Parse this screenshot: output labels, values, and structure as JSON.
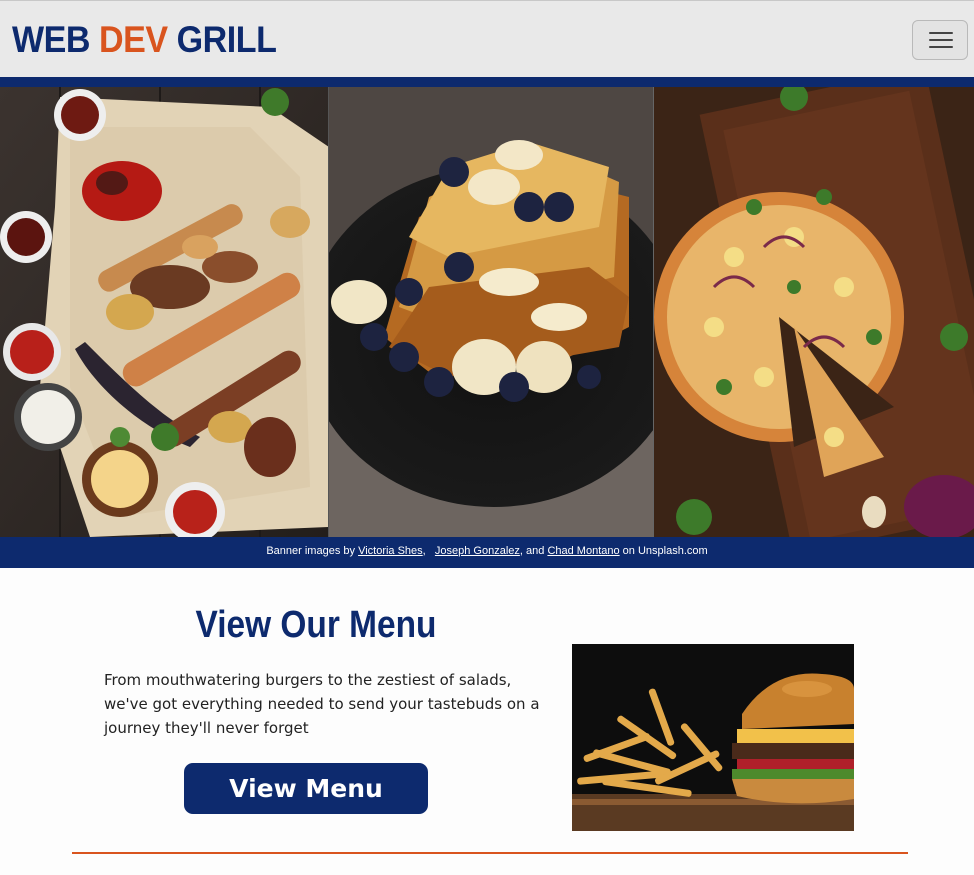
{
  "brand": {
    "part1": "WEB",
    "part2": "DEV",
    "part3": "GRILL"
  },
  "nav": {
    "toggler_icon": "hamburger-menu-icon"
  },
  "banner": {
    "images": [
      {
        "name": "grill-platter-image"
      },
      {
        "name": "french-toast-image"
      },
      {
        "name": "pizza-image"
      }
    ],
    "credit": {
      "prefix": "Banner images by",
      "author1": "Victoria Shes",
      "sep1": ",",
      "author2": "Joseph Gonzalez",
      "sep2": ", and",
      "author3": "Chad Montano",
      "suffix": "on Unsplash.com"
    }
  },
  "menu": {
    "title": "View Our Menu",
    "text": "From mouthwatering burgers to the zestiest of salads, we've got everything needed to send your tastebuds on a journey they'll never forget",
    "button": "View Menu"
  },
  "colors": {
    "navy": "#0d2a6e",
    "orange": "#d9541e"
  }
}
